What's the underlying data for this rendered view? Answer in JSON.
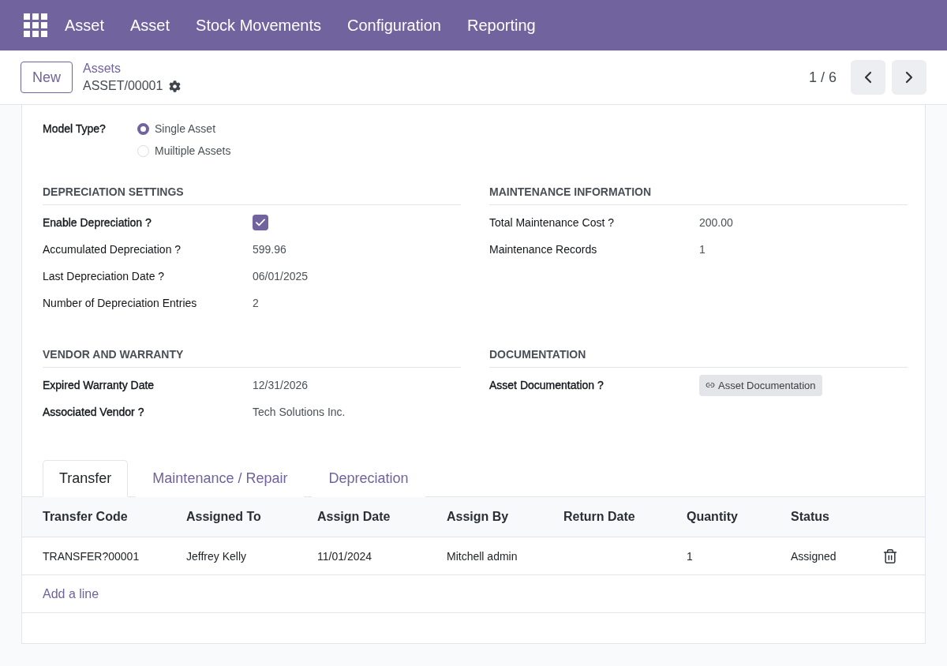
{
  "navbar": {
    "menu": [
      "Asset",
      "Asset",
      "Stock Movements",
      "Configuration",
      "Reporting"
    ]
  },
  "control_panel": {
    "new_button": "New",
    "breadcrumb_parent": "Assets",
    "record_name": "ASSET/00001",
    "pager": "1 / 6"
  },
  "model_type": {
    "label": "Model Type?",
    "readonly": false,
    "options": [
      {
        "label": "Single Asset",
        "selected": true
      },
      {
        "label": "Muiltiple Assets",
        "selected": false
      }
    ]
  },
  "sections": [
    {
      "title": "DEPRECIATION SETTINGS",
      "fields": [
        {
          "label": "Enable Depreciation ?",
          "readonly": false,
          "kind": "checkbox",
          "checked": true
        },
        {
          "label": "Accumulated Depreciation ?",
          "readonly": true,
          "kind": "text",
          "value": "599.96"
        },
        {
          "label": "Last Depreciation Date ?",
          "readonly": true,
          "kind": "text",
          "value": "06/01/2025"
        },
        {
          "label": "Number of Depreciation Entries",
          "readonly": true,
          "kind": "text",
          "value": "2"
        }
      ]
    },
    {
      "title": "MAINTENANCE INFORMATION",
      "fields": [
        {
          "label": "Total Maintenance Cost ?",
          "readonly": true,
          "kind": "text",
          "value": "200.00"
        },
        {
          "label": "Maintenance Records",
          "readonly": true,
          "kind": "text",
          "value": "1"
        }
      ]
    },
    {
      "title": "VENDOR AND WARRANTY",
      "fields": [
        {
          "label": "Expired Warranty Date",
          "readonly": false,
          "kind": "text",
          "value": "12/31/2026"
        },
        {
          "label": "Associated Vendor ?",
          "readonly": false,
          "kind": "text",
          "value": "Tech Solutions Inc."
        }
      ]
    },
    {
      "title": "DOCUMENTATION",
      "fields": [
        {
          "label": "Asset Documentation ?",
          "readonly": false,
          "kind": "link",
          "value": "Asset Documentation"
        }
      ]
    }
  ],
  "notebook": {
    "tabs": [
      {
        "label": "Transfer",
        "selected": true
      },
      {
        "label": "Maintenance / Repair",
        "selected": false
      },
      {
        "label": "Depreciation",
        "selected": false
      }
    ],
    "table": {
      "columns": [
        "Transfer Code",
        "Assigned To",
        "Assign Date",
        "Assign By",
        "Return Date",
        "Quantity",
        "Status"
      ],
      "rows": [
        {
          "transfer_code": "TRANSFER?00001",
          "assigned_to": "Jeffrey Kelly",
          "assign_date": "11/01/2024",
          "assign_by": "Mitchell admin",
          "quantity": "1",
          "status": "Assigned"
        }
      ],
      "add_line": "Add a line"
    }
  }
}
